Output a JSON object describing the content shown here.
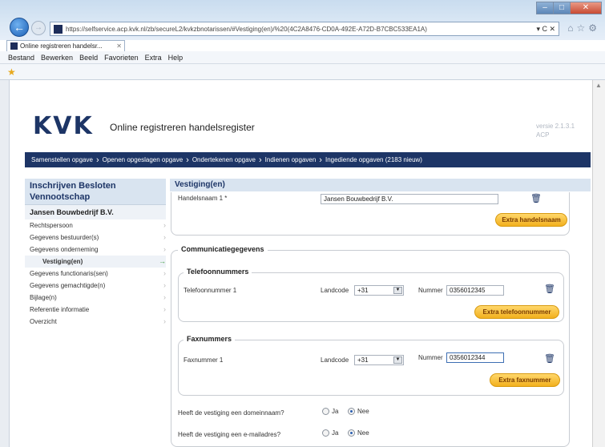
{
  "browser": {
    "url": "https://selfservice.acp.kvk.nl/zb/secureL2/kvkzbnotarissen/#Vestiging(en)/%20(4C2A8476-CD0A-492E-A72D-B7CBC533EA1A)",
    "address_controls": "▾ C ✕",
    "tab_title": "Online registreren handelsr...",
    "menu": [
      "Bestand",
      "Bewerken",
      "Beeld",
      "Favorieten",
      "Extra",
      "Help"
    ]
  },
  "header": {
    "logo": "KVK",
    "title": "Online registreren handelsregister",
    "version_line1": "versie 2.1.3.1",
    "version_line2": "ACP"
  },
  "steps": [
    "Samenstellen opgave",
    "Openen opgeslagen opgave",
    "Ondertekenen opgave",
    "Indienen opgaven",
    "Ingediende opgaven (2183 nieuw)"
  ],
  "sidebar": {
    "heading_line1": "Inschrijven Besloten",
    "heading_line2": "Vennootschap",
    "company": "Jansen Bouwbedrijf B.V.",
    "items": [
      {
        "label": "Rechtspersoon"
      },
      {
        "label": "Gegevens bestuurder(s)"
      },
      {
        "label": "Gegevens onderneming"
      },
      {
        "label": "Vestiging(en)"
      },
      {
        "label": "Gegevens functionaris(sen)"
      },
      {
        "label": "Gegevens gemachtigde(n)"
      },
      {
        "label": "Bijlage(n)"
      },
      {
        "label": "Referentie informatie"
      },
      {
        "label": "Overzicht"
      }
    ]
  },
  "main": {
    "heading": "Vestiging(en)",
    "handelsnaam": {
      "label": "Handelsnaam 1 *",
      "value": "Jansen Bouwbedrijf B.V.",
      "button": "Extra handelsnaam"
    },
    "communicatie": {
      "legend": "Communicatiegegevens",
      "telefoon": {
        "legend": "Telefoonnummers",
        "label": "Telefoonnummer 1",
        "landcode_label": "Landcode",
        "landcode_value": "+31",
        "nummer_label": "Nummer",
        "nummer_value": "0356012345",
        "button": "Extra telefoonnummer"
      },
      "fax": {
        "legend": "Faxnummers",
        "label": "Faxnummer 1",
        "landcode_label": "Landcode",
        "landcode_value": "+31",
        "nummer_label": "Nummer",
        "nummer_value": "0356012344",
        "button": "Extra faxnummer"
      },
      "domein": {
        "question": "Heeft de vestiging een domeinnaam?",
        "ja": "Ja",
        "nee": "Nee",
        "selected": "Nee"
      },
      "email": {
        "question": "Heeft de vestiging een e-mailadres?",
        "ja": "Ja",
        "nee": "Nee",
        "selected": "Nee"
      }
    }
  },
  "colors": {
    "brand": "#1d3566",
    "accent_button": "#f2b01e",
    "panel": "#d9e4f0"
  }
}
